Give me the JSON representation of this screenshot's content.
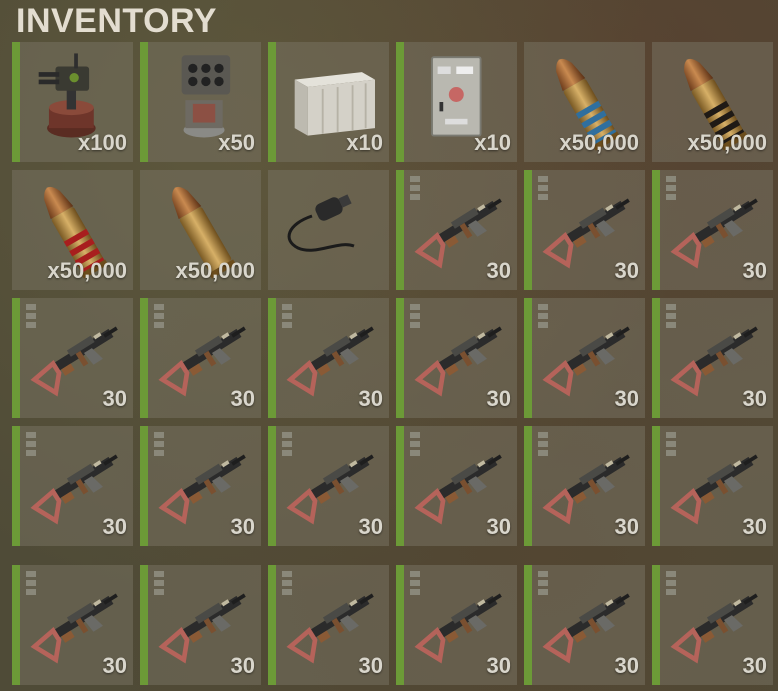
{
  "title": "INVENTORY",
  "colors": {
    "accent_bar": "#6c9a37",
    "qty_text": "#d9d6cc"
  },
  "slots": [
    {
      "icon": "auto-turret-icon",
      "qty": "x100"
    },
    {
      "icon": "sam-site-icon",
      "qty": "x50"
    },
    {
      "icon": "storage-box-icon",
      "qty": "x10"
    },
    {
      "icon": "electrical-panel-icon",
      "qty": "x10"
    },
    {
      "icon": "ammo-blue-bullet-icon",
      "qty": "x50,000"
    },
    {
      "icon": "ammo-black-bullet-icon",
      "qty": "x50,000"
    },
    {
      "icon": "ammo-red-bullet-icon",
      "qty": "x50,000"
    },
    {
      "icon": "ammo-rifle-bullet-icon",
      "qty": "x50,000"
    },
    {
      "icon": "cable-icon",
      "qty": ""
    },
    {
      "icon": "assault-rifle-icon",
      "qty": "30"
    },
    {
      "icon": "assault-rifle-icon",
      "qty": "30"
    },
    {
      "icon": "assault-rifle-icon",
      "qty": "30"
    },
    {
      "icon": "assault-rifle-icon",
      "qty": "30"
    },
    {
      "icon": "assault-rifle-icon",
      "qty": "30"
    },
    {
      "icon": "assault-rifle-icon",
      "qty": "30"
    },
    {
      "icon": "assault-rifle-icon",
      "qty": "30"
    },
    {
      "icon": "assault-rifle-icon",
      "qty": "30"
    },
    {
      "icon": "assault-rifle-icon",
      "qty": "30"
    },
    {
      "icon": "assault-rifle-icon",
      "qty": "30"
    },
    {
      "icon": "assault-rifle-icon",
      "qty": "30"
    },
    {
      "icon": "assault-rifle-icon",
      "qty": "30"
    },
    {
      "icon": "assault-rifle-icon",
      "qty": "30"
    },
    {
      "icon": "assault-rifle-icon",
      "qty": "30"
    },
    {
      "icon": "assault-rifle-icon",
      "qty": "30"
    },
    {
      "icon": "assault-rifle-icon",
      "qty": "30"
    },
    {
      "icon": "assault-rifle-icon",
      "qty": "30"
    },
    {
      "icon": "assault-rifle-icon",
      "qty": "30"
    },
    {
      "icon": "assault-rifle-icon",
      "qty": "30"
    },
    {
      "icon": "assault-rifle-icon",
      "qty": "30"
    },
    {
      "icon": "assault-rifle-icon",
      "qty": "30"
    }
  ]
}
